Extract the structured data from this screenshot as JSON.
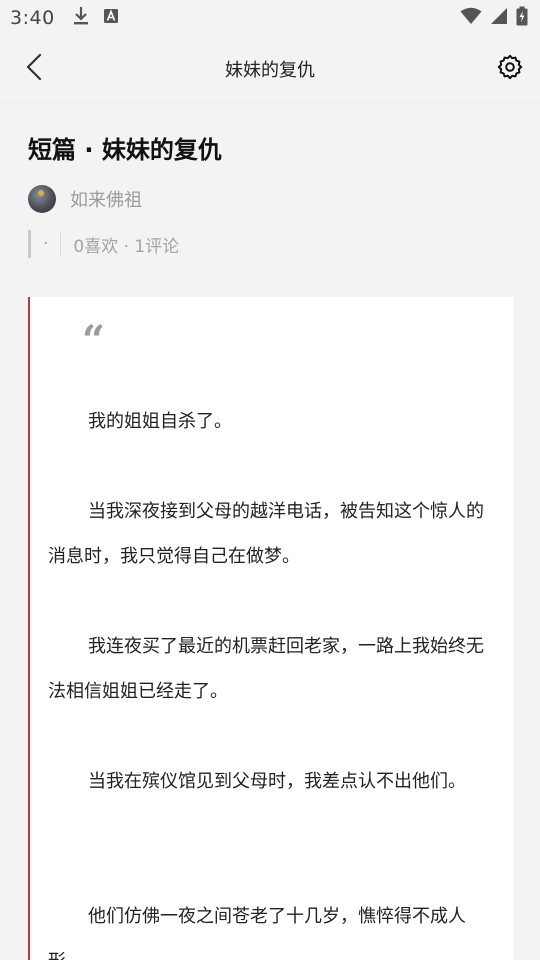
{
  "status_bar": {
    "time": "3:40",
    "icons": [
      "download-icon",
      "a-icon",
      "wifi-icon",
      "signal-icon",
      "battery-icon"
    ]
  },
  "app_bar": {
    "title": "妹妹的复仇",
    "back_icon": "chevron-left-icon",
    "settings_icon": "gear-icon"
  },
  "article": {
    "title": "短篇 · 妹妹的复仇",
    "author": "如来佛祖",
    "stats_dot": "·",
    "stats": "0喜欢 · 1评论"
  },
  "content": {
    "quote_mark": "“",
    "paragraphs": [
      "我的姐姐自杀了。",
      "当我深夜接到父母的越洋电话，被告知这个惊人的消息时，我只觉得自己在做梦。",
      "我连夜买了最近的机票赶回老家，一路上我始终无法相信姐姐已经走了。",
      "当我在殡仪馆见到父母时，我差点认不出他们。",
      "他们仿佛一夜之间苍老了十几岁，憔悴得不成人形。"
    ]
  },
  "colors": {
    "background": "#f3f3f3",
    "card": "#ffffff",
    "accent_border": "#b43c3c",
    "muted_text": "#9b9b9b"
  }
}
